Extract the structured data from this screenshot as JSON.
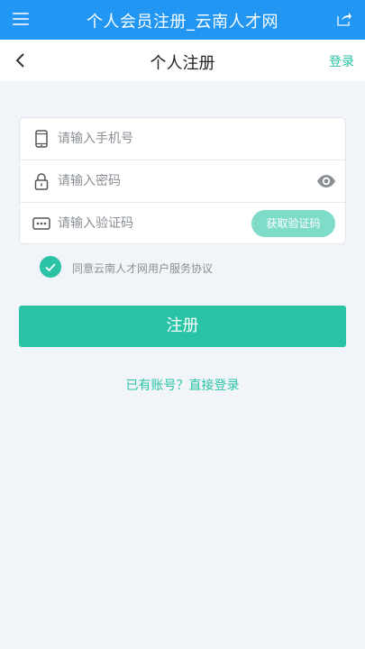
{
  "app": {
    "title": "个人会员注册_云南人才网",
    "menu_icon": "hamburger-menu-icon",
    "share_icon": "share-icon",
    "header_color": "#2196f3"
  },
  "nav": {
    "back_icon": "chevron-left-icon",
    "title": "个人注册",
    "login_label": "登录"
  },
  "form": {
    "phone": {
      "placeholder": "请输入手机号",
      "value": "",
      "icon": "phone-icon"
    },
    "password": {
      "placeholder": "请输入密码",
      "value": "",
      "icon": "lock-icon",
      "toggle_icon": "eye-icon"
    },
    "code": {
      "placeholder": "请输入验证码",
      "value": "",
      "icon": "keyboard-dots-icon",
      "button_label": "获取验证码"
    }
  },
  "agreement": {
    "checked": true,
    "text": "同意云南人才网用户服务协议"
  },
  "register_label": "注册",
  "has_account_label": "已有账号？直接登录",
  "colors": {
    "accent": "#2bc3a5",
    "accent_light": "#7fdcc9",
    "background": "#f1f5f9"
  }
}
